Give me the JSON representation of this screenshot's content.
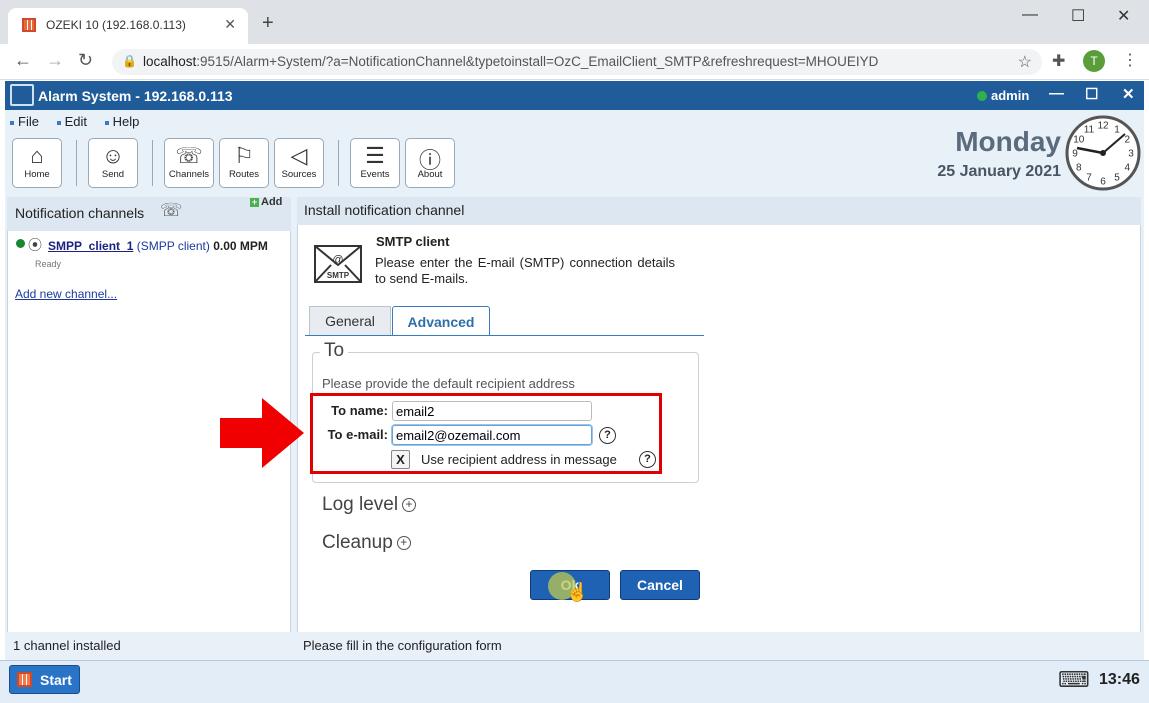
{
  "browser": {
    "tab_title": "OZEKI 10 (192.168.0.113)",
    "close_tab": "✕",
    "new_tab": "+",
    "url_host": "localhost",
    "url_rest": ":9515/Alarm+System/?a=NotificationChannel&typetoinstall=OzC_EmailClient_SMTP&refreshrequest=MHOUEIYD",
    "profile_initial": "T",
    "window_controls": {
      "minimize": "—",
      "maximize": "☐",
      "close": "✕"
    }
  },
  "app": {
    "title": "Alarm System - 192.168.0.113",
    "user": "admin",
    "controls": {
      "minimize": "—",
      "maximize": "☐",
      "close": "✕"
    },
    "menu": [
      "File",
      "Edit",
      "Help"
    ],
    "toolbar": [
      {
        "label": "Home",
        "icon": "home-icon"
      },
      {
        "label": "Send",
        "icon": "send-icon"
      },
      {
        "label": "Channels",
        "icon": "channels-icon"
      },
      {
        "label": "Routes",
        "icon": "routes-icon"
      },
      {
        "label": "Sources",
        "icon": "sources-icon"
      },
      {
        "label": "Events",
        "icon": "events-icon"
      },
      {
        "label": "About",
        "icon": "about-icon"
      }
    ],
    "day": "Monday",
    "date": "25 January 2021",
    "clock_numbers": [
      "12",
      "1",
      "2",
      "3",
      "4",
      "5",
      "6",
      "7",
      "8",
      "9",
      "10",
      "11"
    ]
  },
  "left_panel": {
    "title": "Notification channels",
    "add_label": "Add",
    "channel": {
      "name": "SMPP_client_1",
      "type": "(SMPP client)",
      "rate": "0.00 MPM",
      "status": "Ready"
    },
    "add_new_link": "Add new channel...",
    "status": "1 channel installed"
  },
  "right_panel": {
    "title": "Install notification channel",
    "envelope_text": "SMTP",
    "client_title": "SMTP client",
    "client_desc": "Please enter the E-mail (SMTP) connection details to send E-mails.",
    "tabs": [
      "General",
      "Advanced"
    ],
    "active_tab": "Advanced",
    "section_to": {
      "legend": "To",
      "hint": "Please provide the default recipient address",
      "name_label": "To name:",
      "name_value": "email2",
      "email_label": "To e-mail:",
      "email_value": "email2@ozemail.com",
      "checkbox_mark": "X",
      "checkbox_checked": true,
      "checkbox_label": "Use recipient address in message"
    },
    "sections": [
      "Log level",
      "Cleanup"
    ],
    "ok_label": "Ok",
    "cancel_label": "Cancel",
    "status": "Please fill in the configuration form"
  },
  "taskbar": {
    "start_label": "Start",
    "time": "13:46"
  },
  "colors": {
    "title_bar": "#1f5c99",
    "highlight_box": "#e00000",
    "arrow": "#f00000",
    "button": "#1f62b4",
    "active_tab": "#2e6fa8"
  }
}
